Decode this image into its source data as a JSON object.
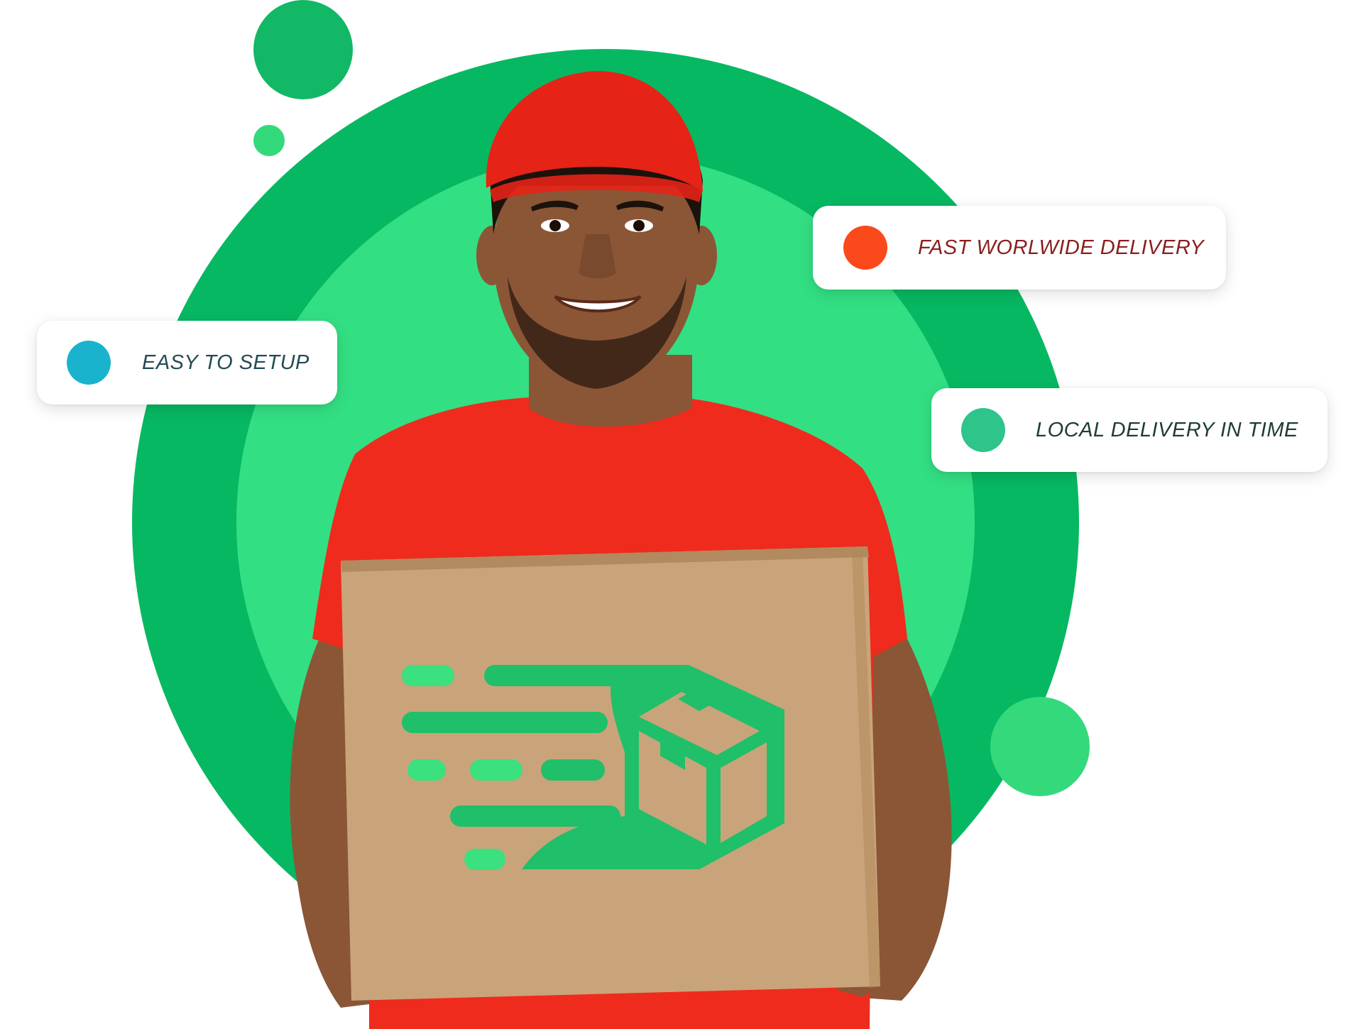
{
  "colors": {
    "outer_circle": "#07b862",
    "inner_circle": "#33df83",
    "bubble_dark": "#12b865",
    "bubble_light": "#34d97c",
    "shirt": "#ef2b1e",
    "cap": "#e62317",
    "skin": "#8a5636",
    "box": "#c9a47a",
    "box_logo": "#20bf69",
    "box_logo_light": "#3be07f"
  },
  "features": [
    {
      "label": "EASY TO SETUP",
      "dot_color": "#1ab3cd",
      "text_color": "#244a55",
      "icon": "status-dot"
    },
    {
      "label": "FAST WORLWIDE DELIVERY",
      "dot_color": "#fa4a1c",
      "text_color": "#8b1e1e",
      "icon": "status-dot"
    },
    {
      "label": "LOCAL DELIVERY IN TIME",
      "dot_color": "#2ec48a",
      "text_color": "#1e3c36",
      "icon": "status-dot"
    }
  ]
}
